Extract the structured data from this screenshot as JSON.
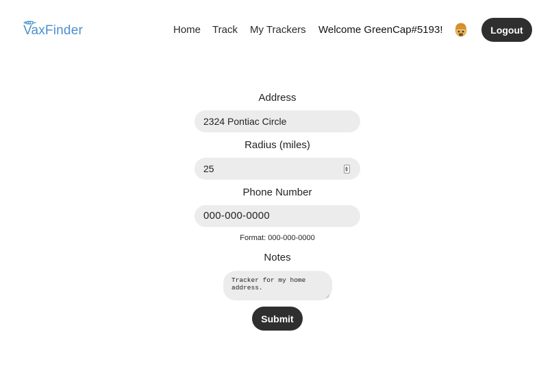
{
  "header": {
    "logo_text": "VaxFinder",
    "brand_color": "#4a8fd0",
    "nav": {
      "home": "Home",
      "track": "Track",
      "my_trackers": "My Trackers"
    },
    "welcome": "Welcome GreenCap#5193!",
    "avatar_icon": "beanie-avatar-icon",
    "logout": "Logout"
  },
  "form": {
    "address_label": "Address",
    "address_value": "2324 Pontiac Circle",
    "radius_label": "Radius (miles)",
    "radius_value": "25",
    "phone_label": "Phone Number",
    "phone_value": "000-000-0000",
    "phone_hint": "Format: 000-000-0000",
    "notes_label": "Notes",
    "notes_value": "Tracker for my home address.",
    "submit": "Submit"
  },
  "colors": {
    "button_bg": "#2f2f2f",
    "input_bg": "#ececec"
  }
}
